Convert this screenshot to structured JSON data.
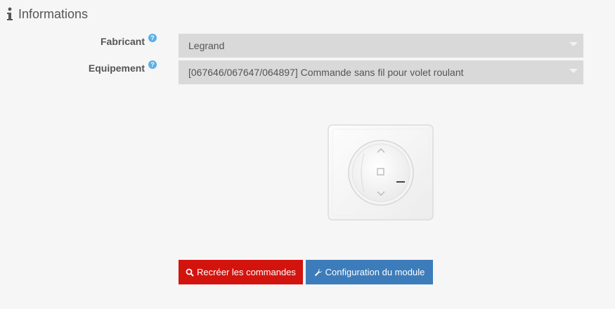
{
  "section": {
    "title": "Informations",
    "icon": "info-icon"
  },
  "form": {
    "fabricant": {
      "label": "Fabricant",
      "help_icon": "help-icon",
      "value": "Legrand"
    },
    "equipement": {
      "label": "Equipement",
      "help_icon": "help-icon",
      "value": "[067646/067647/064897] Commande sans fil pour volet roulant"
    }
  },
  "device_image": {
    "icon": "roller-shutter-switch-image"
  },
  "buttons": {
    "recreate": {
      "label": "Recréer les commandes",
      "icon": "search-icon",
      "color": "#d3140e"
    },
    "config": {
      "label": "Configuration du module",
      "icon": "wrench-icon",
      "color": "#3d7cba"
    }
  }
}
